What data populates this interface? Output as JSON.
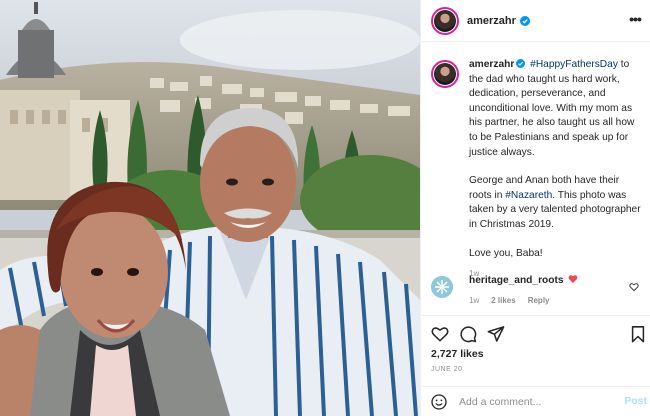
{
  "post": {
    "username": "amerzahr",
    "caption": {
      "hashtag1": "#HappyFathersDay",
      "text1": " to the dad who taught us hard work, dedication, perseverance, and unconditional love. With my mom as his partner, he also taught us all how to be Palestinians and speak up for justice always.",
      "text2a": "George and Anan both have their roots in ",
      "hashtag2": "#Nazareth",
      "text2b": ". This photo was taken by a very talented photographer in Christmas 2019.",
      "text3": "Love you, Baba!",
      "time": "1w"
    },
    "comment": {
      "username": "heritage_and_roots",
      "time": "1w",
      "likes": "2 likes",
      "reply": "Reply"
    },
    "likes_count": "2,727 likes",
    "date": "JUNE 20",
    "add_comment_placeholder": "Add a comment...",
    "post_button": "Post"
  },
  "colors": {
    "verified": "#0095f6",
    "hashtag": "#00376b",
    "heart": "#ed4956",
    "post_button_disabled": "#b2dffc"
  },
  "icons": [
    "verified-badge-icon",
    "more-options-icon",
    "heart-icon",
    "comment-icon",
    "share-icon",
    "bookmark-icon",
    "emoji-icon",
    "red-heart-icon"
  ]
}
